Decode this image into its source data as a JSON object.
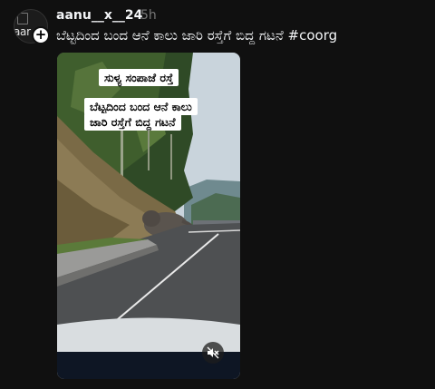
{
  "post": {
    "avatar_alt": "aar",
    "username": "aanu__x__24",
    "timestamp": "5h",
    "caption": "ಬೆಟ್ಟದಿಂದ ಬಂದ ಆನೆ ಕಾಲು ಜಾರಿ ರಸ್ತೆಗೆ ಬಿದ್ದ ಗಟನೆ #coorg"
  },
  "video": {
    "overlay_line1": "ಸುಳ್ಯ ಸಂಪಾಜೆ ರಸ್ತೆ",
    "overlay_line2": "ಬೆಟ್ಟದಿಂದ ಬಂದ ಆನೆ ಕಾಲು",
    "overlay_line3": "ಜಾರಿ ರಸ್ತೆಗೆ ಬಿದ್ದ ಗಟನೆ",
    "mute_icon": "speaker-muted-icon"
  },
  "colors": {
    "background": "#101010",
    "text_primary": "#f3f5f7",
    "text_secondary": "#777777"
  }
}
